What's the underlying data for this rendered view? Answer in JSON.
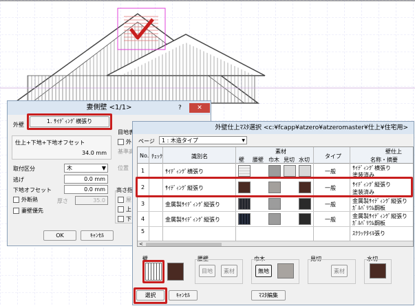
{
  "back_dialog": {
    "title": "妻側壁 <1/1>",
    "help": "?",
    "close": "✕",
    "wall_label": "外壁",
    "wall_button": "1. ｻｲﾃﾞｨﾝｸﾞ横張り",
    "offset_caption": "仕上+下地+下地オフセット",
    "offset_value": "34.0 mm",
    "kubun_label": "取付区分",
    "kubun_value": "木",
    "nige_label": "逃げ",
    "nige_value": "0.0 mm",
    "shitaji_label": "下地オフセット",
    "shitaji_value": "0.0 mm",
    "gaidan_label": "外断熱",
    "atsusa_label": "厚さ",
    "atsusa_value": "35.0",
    "tsuma_label": "妻壁優先",
    "chiken_label": "目地表",
    "chiken_chk": "外",
    "kijun_label": "基準高",
    "ichi_label": "位置",
    "kouhei_label": "高さ指",
    "opt1": "屋",
    "opt2": "上",
    "opt3": "下",
    "ok": "OK",
    "cancel": "ｷｬﾝｾﾙ"
  },
  "main_dialog": {
    "title": "外壁仕上ﾏｽﾀ選択 <c:¥fcapp¥atzero¥atzeromaster¥仕上¥住宅用>",
    "page_label": "ページ",
    "page_value": "1 : 木造タイプ",
    "headers": {
      "no": "No.",
      "check": "ﾁｪｯｸ",
      "name": "識別名",
      "sozai": "素材",
      "wall": "壁",
      "koshi": "腰壁",
      "haba": "巾木",
      "mikiri": "見切",
      "mizukiri": "水切",
      "type": "タイプ",
      "finish": "壁仕上",
      "finish_sub": "名称・摘要"
    },
    "rows": [
      {
        "no": "1",
        "name": "ｻｲﾃﾞｨﾝｸﾞ横張り",
        "type": "一般",
        "desc1": "ｻｲﾃﾞｨﾝｸﾞ横張り",
        "desc2": "塗装済み"
      },
      {
        "no": "2",
        "name": "ｻｲﾃﾞｨﾝｸﾞ縦張り",
        "type": "一般",
        "desc1": "ｻｲﾃﾞｨﾝｸﾞ縦張り",
        "desc2": "塗装済み"
      },
      {
        "no": "3",
        "name": "金属製ｻｲﾃﾞｨﾝｸﾞ縦張り",
        "type": "一般",
        "desc1": "金属製ｻｲﾃﾞｨﾝｸﾞ縦張り",
        "desc2": "ｶﾞﾙﾊﾞﾘｳﾑ鋼板"
      },
      {
        "no": "4",
        "name": "金属製ｻｲﾃﾞｨﾝｸﾞ縦張り",
        "type": "一般",
        "desc1": "金属製ｻｲﾃﾞｨﾝｸﾞ縦張り",
        "desc2": "ｶﾞﾙﾊﾞﾘｳﾑ鋼板"
      },
      {
        "no": "5",
        "name": "",
        "type": "",
        "desc1": "ｽｸﾗｯﾁﾀｲﾙ張り",
        "desc2": ""
      }
    ],
    "preview": {
      "wall": "壁",
      "koshi": "腰壁",
      "haba": "巾木",
      "mikiri": "見切",
      "mizukiri": "水切",
      "mechi": "目地",
      "sozai": "素材",
      "mujisozai": "無地"
    },
    "select": "選択",
    "cancel": "ｷｬﾝｾﾙ",
    "master_edit": "ﾏｽﾀ編集"
  },
  "colors": {
    "accent_red": "#c81e1e",
    "siding_brown": "#4a2a22"
  }
}
